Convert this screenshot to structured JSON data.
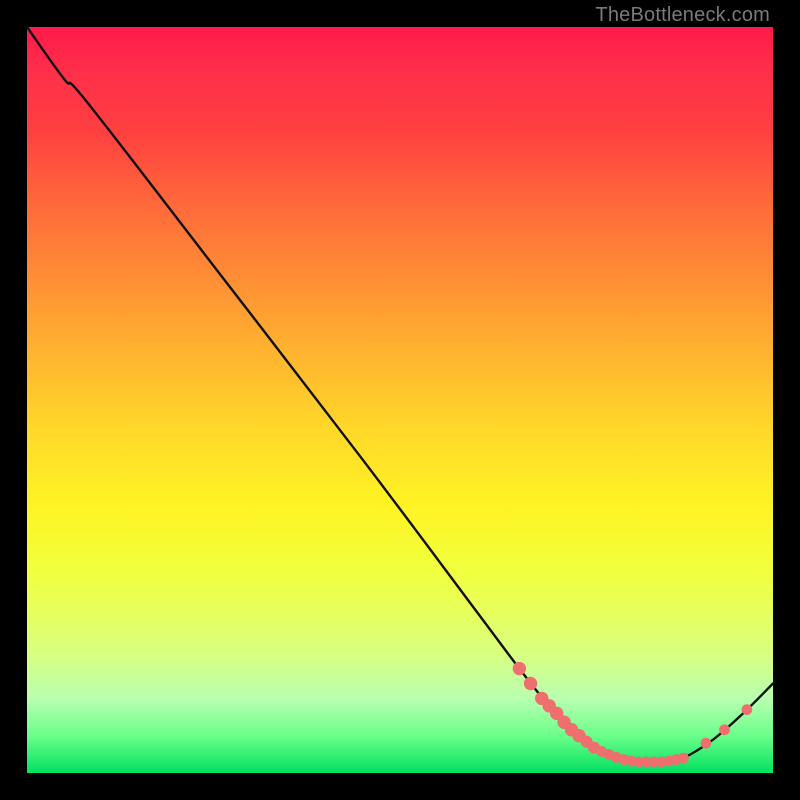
{
  "watermark": "TheBottleneck.com",
  "colors": {
    "background": "#000000",
    "curve_stroke": "#111111",
    "marker_fill": "#ef6e6e",
    "marker_stroke": "#ef6e6e"
  },
  "chart_data": {
    "type": "line",
    "title": "",
    "xlabel": "",
    "ylabel": "",
    "xlim": [
      0,
      100
    ],
    "ylim": [
      0,
      100
    ],
    "series": [
      {
        "name": "curve",
        "x": [
          0,
          5,
          8,
          25,
          45,
          60,
          66,
          70,
          74,
          78,
          82,
          86,
          88,
          92,
          96,
          100
        ],
        "y": [
          100,
          93,
          90,
          68,
          42,
          22,
          14,
          9,
          5,
          2.5,
          1.5,
          1.5,
          2,
          4.5,
          8,
          12
        ]
      }
    ],
    "markers": [
      {
        "x": 66.0,
        "y": 14.0,
        "r": 1.0
      },
      {
        "x": 67.5,
        "y": 12.0,
        "r": 1.0
      },
      {
        "x": 69.0,
        "y": 10.0,
        "r": 1.0
      },
      {
        "x": 70.0,
        "y": 9.0,
        "r": 1.0
      },
      {
        "x": 71.0,
        "y": 8.0,
        "r": 1.0
      },
      {
        "x": 72.0,
        "y": 6.8,
        "r": 1.0
      },
      {
        "x": 73.0,
        "y": 5.8,
        "r": 1.0
      },
      {
        "x": 74.0,
        "y": 5.0,
        "r": 1.0
      },
      {
        "x": 75.0,
        "y": 4.2,
        "r": 0.9
      },
      {
        "x": 76.0,
        "y": 3.4,
        "r": 0.9
      },
      {
        "x": 77.0,
        "y": 2.9,
        "r": 0.8
      },
      {
        "x": 78.0,
        "y": 2.5,
        "r": 0.8
      },
      {
        "x": 79.0,
        "y": 2.1,
        "r": 0.8
      },
      {
        "x": 80.0,
        "y": 1.8,
        "r": 0.8
      },
      {
        "x": 81.0,
        "y": 1.6,
        "r": 0.8
      },
      {
        "x": 82.0,
        "y": 1.5,
        "r": 0.8
      },
      {
        "x": 83.0,
        "y": 1.5,
        "r": 0.8
      },
      {
        "x": 84.0,
        "y": 1.5,
        "r": 0.8
      },
      {
        "x": 85.0,
        "y": 1.5,
        "r": 0.8
      },
      {
        "x": 86.0,
        "y": 1.6,
        "r": 0.8
      },
      {
        "x": 87.0,
        "y": 1.8,
        "r": 0.8
      },
      {
        "x": 88.0,
        "y": 2.0,
        "r": 0.8
      },
      {
        "x": 91.0,
        "y": 4.0,
        "r": 0.8
      },
      {
        "x": 93.5,
        "y": 5.8,
        "r": 0.8
      },
      {
        "x": 96.5,
        "y": 8.5,
        "r": 0.8
      }
    ]
  }
}
